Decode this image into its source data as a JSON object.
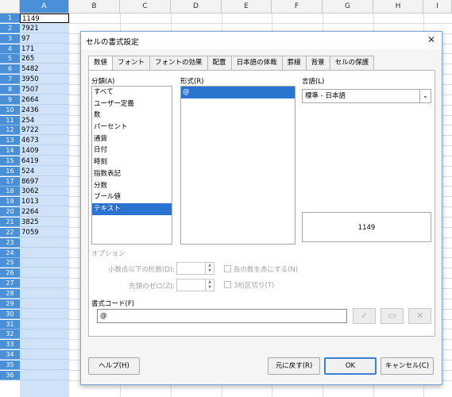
{
  "spreadsheet": {
    "columns": [
      "A",
      "B",
      "C",
      "D",
      "E",
      "F",
      "G",
      "H",
      "I"
    ],
    "selected_column": "A",
    "rows": [
      "1",
      "2",
      "3",
      "4",
      "5",
      "6",
      "7",
      "8",
      "9",
      "10",
      "11",
      "12",
      "13",
      "14",
      "15",
      "16",
      "17",
      "18",
      "19",
      "20",
      "21",
      "22",
      "23",
      "24",
      "25",
      "26",
      "27",
      "28",
      "29",
      "30",
      "31",
      "32",
      "33",
      "34",
      "35",
      "36"
    ],
    "column_a_values": [
      "1149",
      "7921",
      "97",
      "171",
      "265",
      "5482",
      "3950",
      "7507",
      "2664",
      "2436",
      "254",
      "9722",
      "4673",
      "1409",
      "6419",
      "524",
      "8697",
      "3062",
      "1013",
      "2264",
      "3825",
      "7059"
    ]
  },
  "dialog": {
    "title": "セルの書式設定",
    "close_icon": "close-icon",
    "tabs": [
      "数値",
      "フォント",
      "フォントの効果",
      "配置",
      "日本語の体裁",
      "罫線",
      "背景",
      "セルの保護"
    ],
    "active_tab": "数値",
    "category": {
      "label": "分類(A)",
      "items": [
        "すべて",
        "ユーザー定義",
        "数",
        "パーセント",
        "通貨",
        "日付",
        "時刻",
        "指数表記",
        "分数",
        "ブール値",
        "テキスト"
      ],
      "selected": "テキスト"
    },
    "format": {
      "label": "形式(R)",
      "items": [
        "@"
      ],
      "selected": "@"
    },
    "language": {
      "label": "言語(L)",
      "value": "標準 - 日本語"
    },
    "preview_value": "1149",
    "options": {
      "label": "オプション",
      "decimal_places_label": "小数点以下の桁数(D):",
      "leading_zeros_label": "先頭のゼロ(Z):",
      "negative_red_label": "負の数を赤にする(N)",
      "thousands_sep_label": "3桁区切り(T)"
    },
    "format_code": {
      "label": "書式コード(F)",
      "value": "@"
    },
    "buttons": {
      "help": "ヘルプ(H)",
      "reset": "元に戻す(R)",
      "ok": "OK",
      "cancel": "キャンセル(C)"
    },
    "icon_buttons": {
      "accept": "✓",
      "comment": "▭",
      "delete": "✕"
    }
  }
}
